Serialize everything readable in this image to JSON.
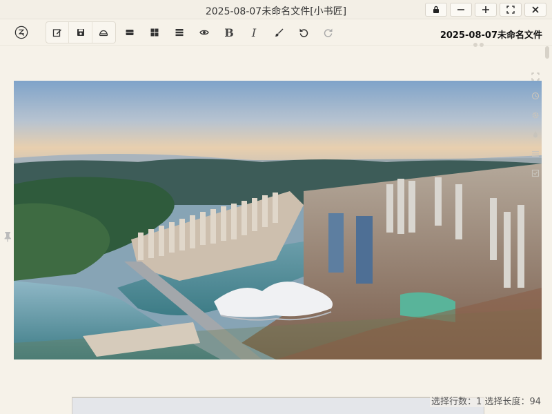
{
  "window": {
    "title": "2025-08-07未命名文件[小书匠]"
  },
  "window_controls": [
    "lock-icon",
    "minimize-icon",
    "maximize-icon",
    "fullscreen-icon",
    "close-icon"
  ],
  "toolbar": {
    "logo_icon": "xiaoshujiang-logo",
    "file_group": [
      "edit-icon",
      "save-icon",
      "sync-icon"
    ],
    "format_buttons": [
      "layout-list-icon",
      "grid-icon",
      "multiline-icon",
      "preview-eye-icon",
      "bold-icon",
      "italic-icon",
      "brush-icon",
      "undo-icon",
      "redo-icon"
    ],
    "bold_label": "B",
    "italic_label": "I",
    "document_name": "2025-08-07未命名文件"
  },
  "side_tools": [
    "expand-icon",
    "history-icon",
    "settings-icon",
    "ink-drop-icon",
    "menu-icon",
    "checklist-icon"
  ],
  "status": {
    "text": "选择行数：1 选择长度：94"
  },
  "colors": {
    "background": "#f6f2e9",
    "titlebar": "#f3efe6",
    "text": "#333333"
  }
}
